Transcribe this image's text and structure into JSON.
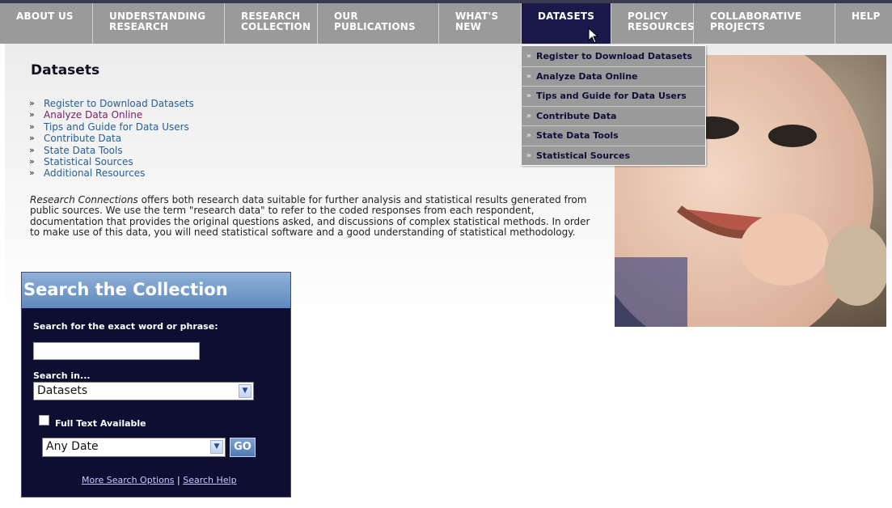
{
  "nav": {
    "items": [
      {
        "line1": "ABOUT US",
        "line2": ""
      },
      {
        "line1": "UNDERSTANDING",
        "line2": "RESEARCH"
      },
      {
        "line1": "RESEARCH",
        "line2": "COLLECTION"
      },
      {
        "line1": "OUR",
        "line2": "PUBLICATIONS"
      },
      {
        "line1": "WHAT'S",
        "line2": "NEW"
      },
      {
        "line1": "DATASETS",
        "line2": ""
      },
      {
        "line1": "POLICY",
        "line2": "RESOURCES"
      },
      {
        "line1": "COLLABORATIVE",
        "line2": "PROJECTS"
      },
      {
        "line1": "HELP",
        "line2": ""
      }
    ],
    "active": "DATASETS"
  },
  "page": {
    "title": "Datasets",
    "links": [
      "Register to Download Datasets",
      "Analyze Data Online",
      "Tips and Guide for Data Users",
      "Contribute Data",
      "State Data Tools",
      "Statistical Sources",
      "Additional Resources"
    ],
    "bullet": "»",
    "description_italic": "Research Connections",
    "description_rest": " offers both research data suitable for further analysis and statistical results generated from public sources. We use the term \"research data\" to refer to the coded responses from each respondent, documentation that provides the original questions asked, and discussions of complex statistical methods. In order to make use of this data, you will need statistical software and a good understanding of statistical methodology."
  },
  "dropdown": {
    "items": [
      "Register to Download Datasets",
      "Analyze Data Online",
      "Tips and Guide for Data Users",
      "Contribute Data",
      "State Data Tools",
      "Statistical Sources"
    ]
  },
  "search": {
    "header": "Search the Collection",
    "exact_label": "Search for the exact word or phrase:",
    "input_value": "",
    "search_in_label": "Search in...",
    "search_in_value": "Datasets",
    "full_text_label": "Full Text Available",
    "date_value": "Any Date",
    "go_label": "GO",
    "more_options": "More Search Options",
    "separator": "|",
    "help": "Search Help"
  },
  "colors": {
    "nav_bg": "#9a9a9a",
    "nav_active": "#1a1a4a",
    "search_bg": "#0e0e33",
    "link": "#24609a"
  }
}
